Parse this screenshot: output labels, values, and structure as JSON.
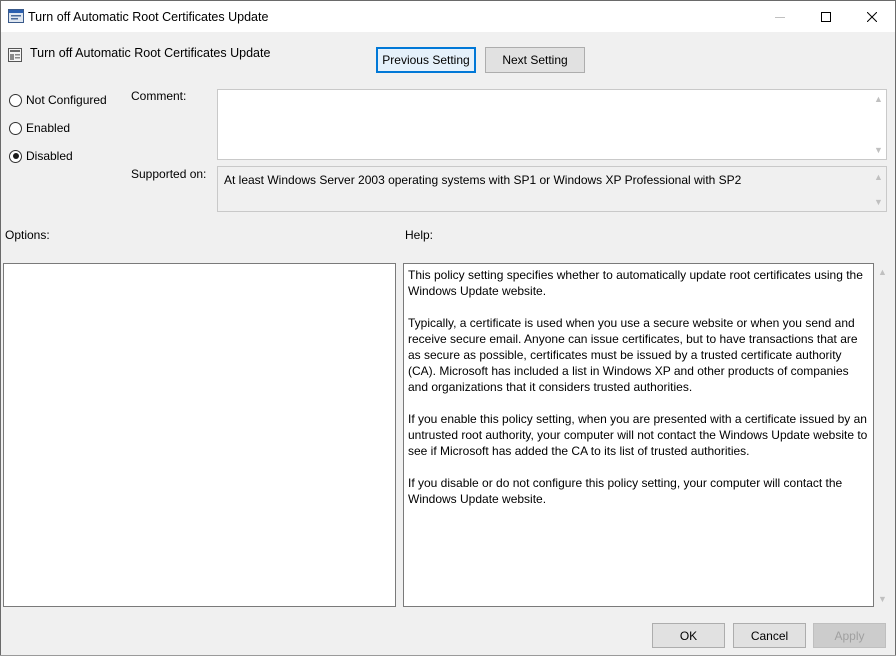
{
  "window": {
    "title": "Turn off Automatic Root Certificates Update"
  },
  "header": {
    "title": "Turn off Automatic Root Certificates Update",
    "previous_label": "Previous Setting",
    "next_label": "Next Setting"
  },
  "state": {
    "options": [
      {
        "label": "Not Configured",
        "checked": false
      },
      {
        "label": "Enabled",
        "checked": false
      },
      {
        "label": "Disabled",
        "checked": true
      }
    ]
  },
  "comment": {
    "label": "Comment:",
    "value": ""
  },
  "supported": {
    "label": "Supported on:",
    "value": "At least Windows Server 2003 operating systems with SP1 or Windows XP Professional with SP2"
  },
  "options_label": "Options:",
  "help": {
    "label": "Help:",
    "paragraphs": [
      "This policy setting specifies whether to automatically update root certificates using the Windows Update website.",
      "Typically, a certificate is used when you use a secure website or when you send and receive secure email. Anyone can issue certificates, but to have transactions that are as secure as possible, certificates must be issued by a trusted certificate authority (CA). Microsoft has included a list in Windows XP and other products of companies and organizations that it considers trusted authorities.",
      "If you enable this policy setting, when you are presented with a certificate issued by an untrusted root authority, your computer will not contact the Windows Update website to see if Microsoft has added the CA to its list of trusted authorities.",
      "If you disable or do not configure this policy setting, your computer will contact the Windows Update website."
    ]
  },
  "footer": {
    "ok_label": "OK",
    "cancel_label": "Cancel",
    "apply_label": "Apply"
  },
  "colors": {
    "focus_border": "#0078d7",
    "dialog_bg": "#f0f0f0"
  },
  "icons": {
    "app": "policy-window-icon",
    "header": "policy-setting-icon"
  }
}
